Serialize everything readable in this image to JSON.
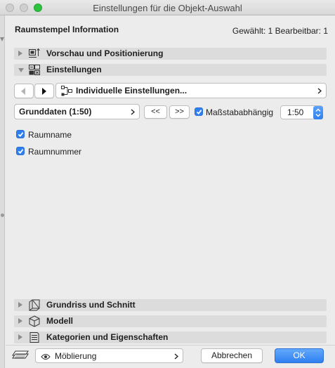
{
  "window": {
    "title": "Einstellungen für die Objekt-Auswahl"
  },
  "header": {
    "title": "Raumstempel Information",
    "info": "Gewählt: 1 Bearbeitbar: 1"
  },
  "sections": {
    "vorschau": "Vorschau und Positionierung",
    "einstellungen": "Einstellungen",
    "grundriss": "Grundriss und Schnitt",
    "modell": "Modell",
    "kategorien": "Kategorien und Eigenschaften"
  },
  "settings": {
    "preset_label": "Individuelle Einstellungen...",
    "view_label": "Grunddaten (1:50)",
    "prev_label": "<<",
    "next_label": ">>",
    "scale_dependent_label": "Maßstababhängig",
    "scale_dependent_checked": true,
    "scale_value": "1:50"
  },
  "options": [
    {
      "label": "Raumname",
      "checked": true
    },
    {
      "label": "Raumnummer",
      "checked": true
    }
  ],
  "footer": {
    "layer_label": "Möblierung",
    "cancel_label": "Abbrechen",
    "ok_label": "OK"
  },
  "colors": {
    "accent": "#2f7ff0",
    "section_bg": "#dcdcdc",
    "window_bg": "#ececec"
  }
}
